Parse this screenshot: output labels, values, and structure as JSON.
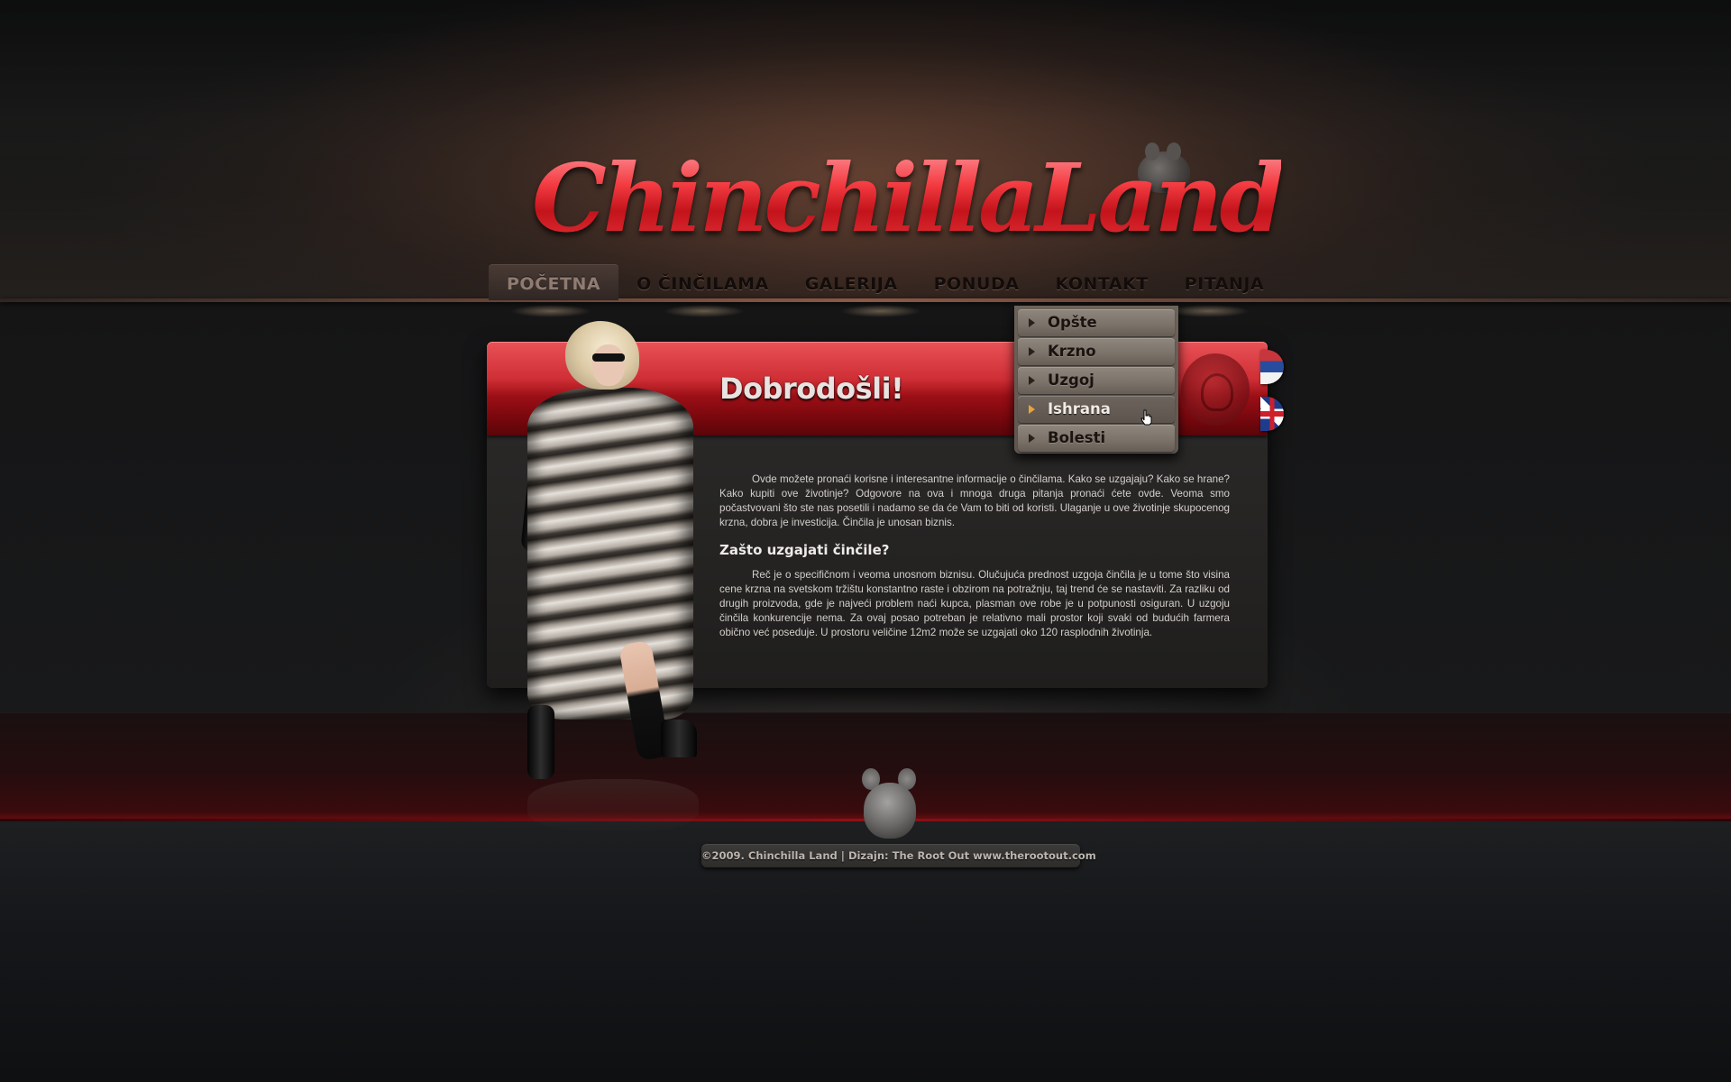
{
  "site": {
    "logo_text": "ChinchillaLand"
  },
  "nav": {
    "items": [
      "POČETNA",
      "O ČINČILAMA",
      "GALERIJA",
      "PONUDA",
      "KONTAKT",
      "PITANJA"
    ],
    "active": "POČETNA"
  },
  "dropdown": {
    "items": [
      "Opšte",
      "Krzno",
      "Uzgoj",
      "Ishrana",
      "Bolesti"
    ],
    "hovered": "Ishrana"
  },
  "content": {
    "title": "Dobrodošli!",
    "intro": "Ovde možete pronaći korisne i interesantne informacije o činčilama. Kako se uzgajaju? Kako se hrane? Kako kupiti ove životinje? Odgovore na ova i mnoga druga pitanja pronaći ćete ovde. Veoma smo počastvovani što ste nas posetili i nadamo se da će Vam to biti od koristi. Ulaganje u ove životinje skupocenog krzna, dobra je investicija. Činčila je unosan biznis.",
    "subtitle": "Zašto uzgajati činčile?",
    "body": "Reč je o specifičnom i veoma unosnom biznisu. Olučujuća prednost uzgoja činčila je u tome što visina cene krzna na svetskom tržištu konstantno raste i obzirom na potražnju, taj trend će se nastaviti. Za razliku od drugih proizvoda, gde je najveći problem naći kupca, plasman ove robe je u potpunosti osiguran. U uzgoju činčila konkurencije nema. Za ovaj posao potreban je relativno mali prostor koji svaki od budućih farmera obično već poseduje. U prostoru veličine 12m2 može se uzgajati oko 120 rasplodnih životinja."
  },
  "languages": [
    "serbian-flag",
    "uk-flag"
  ],
  "footer": {
    "text": "©2009. Chinchilla Land | Dizajn: The Root Out www.therootout.com"
  },
  "colors": {
    "accent_red": "#d1252c",
    "nav_text": "#120c0a",
    "dropdown_bg": "#7a7168",
    "hover_arrow": "#e9a33b"
  }
}
